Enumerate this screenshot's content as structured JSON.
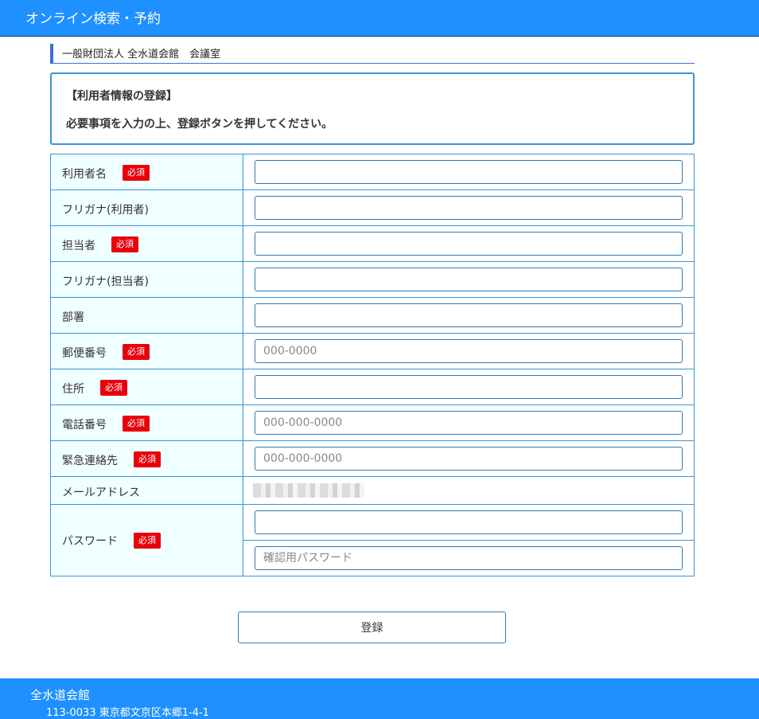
{
  "header": {
    "title": "オンライン検索・予約"
  },
  "facility": {
    "name": "一般財団法人 全水道会館　会議室"
  },
  "notice": {
    "heading": "【利用者情報の登録】",
    "message": "必要事項を入力の上、登録ボタンを押してください。"
  },
  "required_label": "必須",
  "form": {
    "user_name": {
      "label": "利用者名",
      "value": ""
    },
    "user_kana": {
      "label": "フリガナ(利用者)",
      "value": ""
    },
    "contact_person": {
      "label": "担当者",
      "value": ""
    },
    "contact_kana": {
      "label": "フリガナ(担当者)",
      "value": ""
    },
    "department": {
      "label": "部署",
      "value": ""
    },
    "postal_code": {
      "label": "郵便番号",
      "value": "",
      "placeholder": "000-0000"
    },
    "address": {
      "label": "住所",
      "value": ""
    },
    "phone": {
      "label": "電話番号",
      "value": "",
      "placeholder": "000-000-0000"
    },
    "emergency": {
      "label": "緊急連絡先",
      "value": "",
      "placeholder": "000-000-0000"
    },
    "email": {
      "label": "メールアドレス"
    },
    "password": {
      "label": "パスワード",
      "value": "",
      "confirm_placeholder": "確認用パスワード"
    }
  },
  "submit": {
    "label": "登録"
  },
  "footer": {
    "name": "全水道会館",
    "address": "113-0033 東京都文京区本郷1-4-1"
  },
  "colors": {
    "brand": "#1e90ff",
    "required": "#e8000b",
    "label_bg": "#f0ffff",
    "border": "#3a95d4"
  }
}
